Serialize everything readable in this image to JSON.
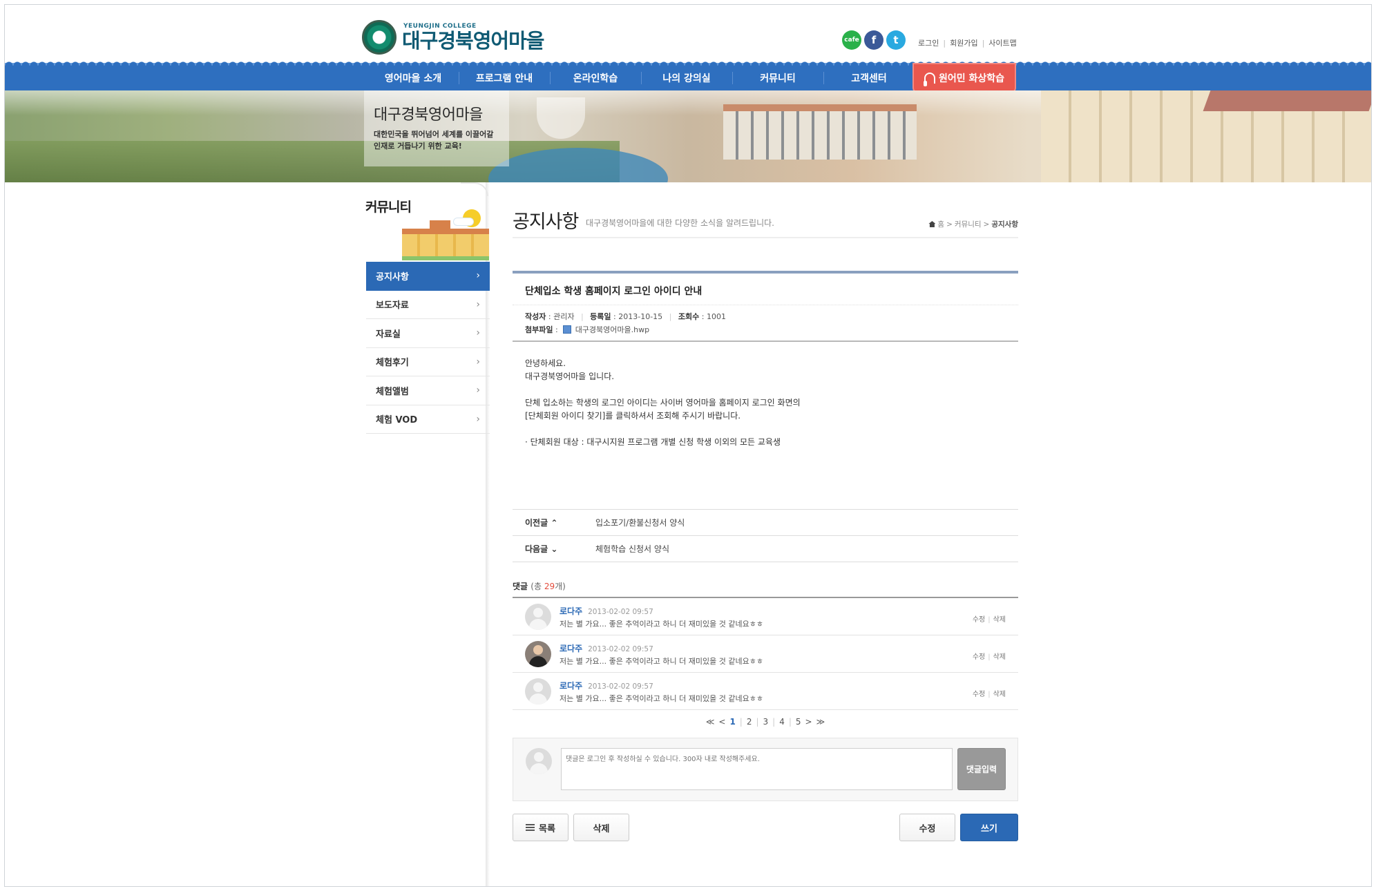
{
  "header": {
    "logo_sub": "YEUNGJIN COLLEGE",
    "logo_main": "대구경북영어마을",
    "social": {
      "cafe": "cafe",
      "facebook": "f",
      "twitter": "t"
    },
    "util": [
      "로그인",
      "회원가입",
      "사이트맵"
    ]
  },
  "nav": {
    "items": [
      "영어마을 소개",
      "프로그램 안내",
      "온라인학습",
      "나의 강의실",
      "커뮤니티",
      "고객센터"
    ],
    "live": "원어민 화상학습"
  },
  "banner": {
    "title": "대구경북영어마을",
    "sub1": "대한민국을 뛰어넘어 세계를 이끌어갈",
    "sub2": "인재로 거듭나기 위한 교육!"
  },
  "sidebar": {
    "title": "커뮤니티",
    "items": [
      "공지사항",
      "보도자료",
      "자료실",
      "체험후기",
      "체험앨범",
      "체험 VOD"
    ]
  },
  "page": {
    "title": "공지사항",
    "desc": "대구경북영어마을에 대한 다양한 소식을 알려드립니다.",
    "breadcrumb": [
      "홈",
      "커뮤니티",
      "공지사항"
    ]
  },
  "article": {
    "title": "단체입소 학생 홈페이지 로그인 아이디 안내",
    "author_label": "작성자",
    "author": "관리자",
    "date_label": "등록일",
    "date": "2013-10-15",
    "views_label": "조회수",
    "views": "1001",
    "file_label": "첨부파일",
    "file": "대구경북영어마을.hwp",
    "body": [
      "안녕하세요.",
      "대구경북영어마을 입니다.",
      "",
      "단체 입소하는 학생의 로그인 아이디는 사이버 영어마을 홈페이지 로그인 화면의",
      "[단체회원 아이디 찾기]를 클릭하셔서 조회해 주시기 바랍니다.",
      "",
      "· 단체회원 대상 : 대구시지원 프로그램 개별 신청 학생 이외의 모든 교육생"
    ]
  },
  "prevnext": {
    "prev_label": "이전글",
    "prev": "입소포기/환불신청서 양식",
    "next_label": "다음글",
    "next": "체험학습 신청서 양식"
  },
  "comments": {
    "label": "댓글",
    "total_prefix": "(총 ",
    "count": "29",
    "total_suffix": "개)",
    "items": [
      {
        "name": "로다주",
        "date": "2013-02-02 09:57",
        "text": "저는 별 가요... 좋은 추억이라고 하니 더 재미있을 것 같네요ㅎㅎ"
      },
      {
        "name": "로다주",
        "date": "2013-02-02 09:57",
        "text": "저는 별 가요... 좋은 추억이라고 하니 더 재미있을 것 같네요ㅎㅎ"
      },
      {
        "name": "로다주",
        "date": "2013-02-02 09:57",
        "text": "저는 별 가요... 좋은 추억이라고 하니 더 재미있을 것 같네요ㅎㅎ"
      }
    ],
    "edit": "수정",
    "delete": "삭제",
    "pages": [
      "1",
      "2",
      "3",
      "4",
      "5"
    ],
    "first": "≪",
    "prev": "<",
    "next": ">",
    "last": "≫",
    "placeholder": "댓글은 로그인 후 작성하실 수 있습니다. 300자 내로 작성해주세요.",
    "submit": "댓글입력"
  },
  "buttons": {
    "list": "목록",
    "delete": "삭제",
    "edit": "수정",
    "write": "쓰기"
  }
}
